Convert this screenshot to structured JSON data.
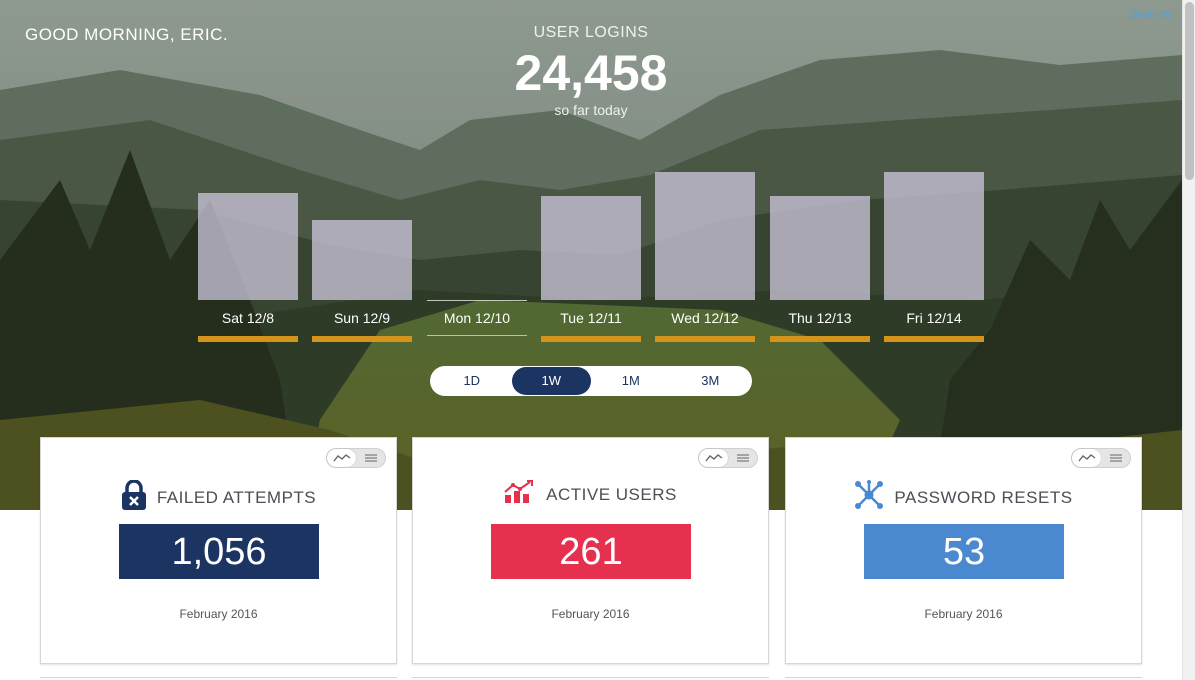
{
  "header": {
    "greeting": "GOOD MORNING, ERIC.",
    "source_link": "Source"
  },
  "headline": {
    "label": "USER LOGINS",
    "value": "24,458",
    "subtitle": "so far today"
  },
  "chart_data": {
    "type": "bar",
    "categories": [
      "Sat 12/8",
      "Sun 12/9",
      "Mon 12/10",
      "Tue 12/11",
      "Wed 12/12",
      "Thu 12/13",
      "Fri 12/14"
    ],
    "values": [
      107,
      80,
      0,
      104,
      128,
      104,
      128
    ],
    "ylim": [
      0,
      128
    ],
    "bar_color": "#c8c3d7",
    "underline_color": "#d4931b"
  },
  "range_selector": {
    "options": [
      "1D",
      "1W",
      "1M",
      "3M"
    ],
    "selected": "1W"
  },
  "cards": [
    {
      "title": "FAILED ATTEMPTS",
      "value": "1,056",
      "period": "February 2016",
      "color": "#1b3461",
      "icon": "lock-x-icon"
    },
    {
      "title": "ACTIVE USERS",
      "value": "261",
      "period": "February 2016",
      "color": "#e5304e",
      "icon": "trend-chart-icon"
    },
    {
      "title": "PASSWORD RESETS",
      "value": "53",
      "period": "February 2016",
      "color": "#4a89cf",
      "icon": "network-icon"
    }
  ],
  "colors": {
    "navy": "#1b3461",
    "gold": "#d4931b",
    "link": "#4aa3df"
  }
}
